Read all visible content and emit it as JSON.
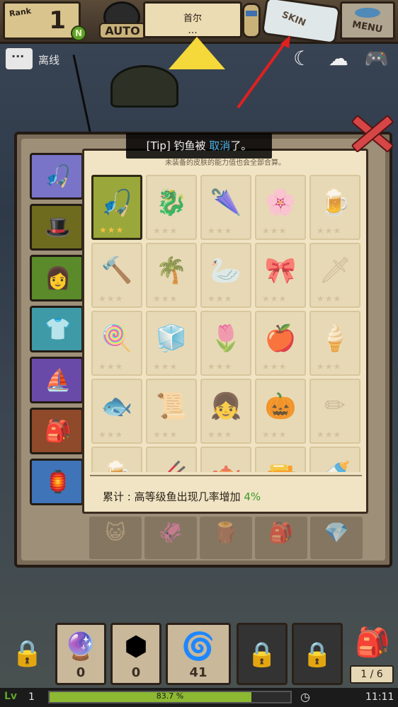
{
  "topbar": {
    "rank_label": "Rank",
    "rank_value": "1",
    "rank_badge": "N",
    "auto_label": "AUTO",
    "location": "首尔",
    "location_dots": "...",
    "skin_label": "SKIN",
    "menu_label": "MENU"
  },
  "status": {
    "chat_icon": "chat-bubble-icon",
    "offline_label": "离线",
    "icons": [
      "moon-icon",
      "cloud-upload-icon",
      "gamepad-icon"
    ]
  },
  "tip": {
    "prefix": "[Tip] 钓鱼被 ",
    "accent": "取消",
    "suffix": "了。"
  },
  "panel": {
    "note": "未装备的皮肤的能力值也会全部合算。",
    "summary_prefix": "累计 : 高等级鱼出现几率增加 ",
    "summary_pct": "4%",
    "tabs": [
      {
        "name": "tab-fishing-rod",
        "icon": "🎣",
        "bg": "#7a74c8"
      },
      {
        "name": "tab-hat",
        "icon": "🎩",
        "bg": "#6e6a1e"
      },
      {
        "name": "tab-hair",
        "icon": "👩",
        "bg": "#5a8a2a"
      },
      {
        "name": "tab-clothes",
        "icon": "👕",
        "bg": "#3f9aa8"
      },
      {
        "name": "tab-boat",
        "icon": "⛵",
        "bg": "#6a4aa8"
      },
      {
        "name": "tab-bag",
        "icon": "🎒",
        "bg": "#8e4a2a"
      },
      {
        "name": "tab-lantern",
        "icon": "🏮",
        "bg": "#3f74b8"
      }
    ],
    "cells": [
      {
        "icon": "🎣",
        "selected": true,
        "stars": "★★★"
      },
      {
        "icon": "🐉",
        "stars": "★★★"
      },
      {
        "icon": "🌂",
        "stars": "★★★"
      },
      {
        "icon": "🌸",
        "stars": "★★★"
      },
      {
        "icon": "🍺",
        "stars": "★★★"
      },
      {
        "icon": "🔨",
        "stars": "★★★"
      },
      {
        "icon": "🌴",
        "stars": "★★★"
      },
      {
        "icon": "🦢",
        "stars": "★★★"
      },
      {
        "icon": "🎀",
        "stars": "★★★"
      },
      {
        "icon": "🗡",
        "stars": "★★★"
      },
      {
        "icon": "🍭",
        "stars": "★★★"
      },
      {
        "icon": "🧊",
        "stars": "★★★"
      },
      {
        "icon": "🌷",
        "stars": "★★★"
      },
      {
        "icon": "🍎",
        "stars": "★★★"
      },
      {
        "icon": "🍦",
        "stars": "★★★"
      },
      {
        "icon": "🐟",
        "stars": "★★★"
      },
      {
        "icon": "📜",
        "stars": "★★★"
      },
      {
        "icon": "👧",
        "stars": "★★★"
      },
      {
        "icon": "🎃",
        "stars": "★★★"
      },
      {
        "icon": "✏",
        "stars": "★★★"
      },
      {
        "icon": "🍺",
        "stars": ""
      },
      {
        "icon": "🥢",
        "stars": ""
      },
      {
        "icon": "🫖",
        "stars": ""
      },
      {
        "icon": "🔫",
        "stars": ""
      },
      {
        "icon": "🍼",
        "stars": ""
      }
    ],
    "faded_row": [
      "😺",
      "🦑",
      "🪵",
      "🎒",
      "💎"
    ]
  },
  "bottom": {
    "slots": [
      {
        "icon": "🔮",
        "count": "0",
        "kind": "paper"
      },
      {
        "icon": "⬢",
        "count": "0",
        "kind": "paper"
      },
      {
        "icon": "🌀",
        "count": "41",
        "kind": "paper"
      },
      {
        "lock": true,
        "kind": "dark"
      },
      {
        "lock": true,
        "kind": "dark"
      }
    ],
    "page": "1 / 6",
    "level": "1",
    "xp_text": "83.7 %",
    "xp_fraction": 0.837,
    "time": "11:11"
  }
}
